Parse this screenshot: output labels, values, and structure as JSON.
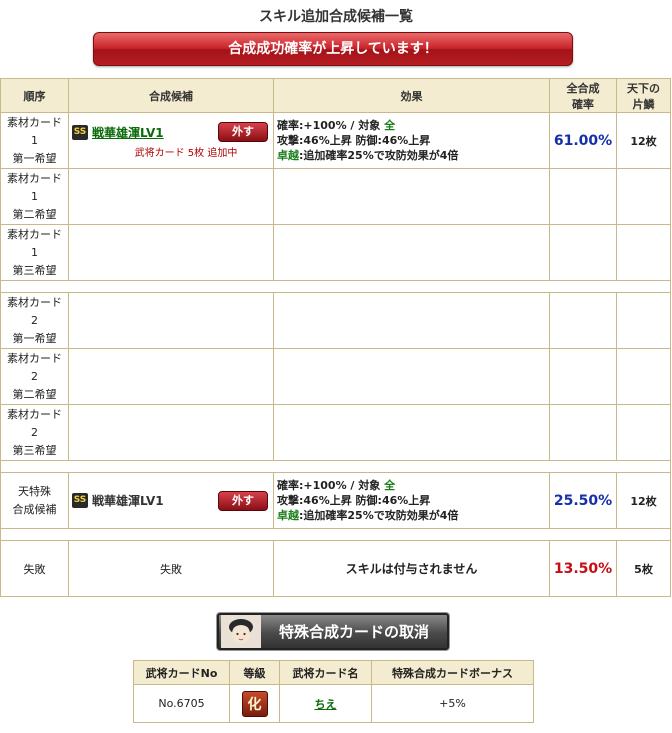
{
  "page_title": "スキル追加合成候補一覧",
  "banner_text": "合成成功確率が上昇しています！",
  "headers": {
    "order": "順序",
    "candidate": "合成候補",
    "effect": "効果",
    "rate_line1": "全合成",
    "rate_line2": "確率",
    "count_line1": "天下の",
    "count_line2": "片鱗"
  },
  "rows": {
    "r1": {
      "order1": "素材カード1",
      "order2": "第一希望",
      "badge": "SS",
      "card": "戦華雄渾LV1",
      "remove": "外す",
      "note": "武将カード 5枚 追加中",
      "eff1a": "確率:+100% / 対象 ",
      "eff1b": "全",
      "eff2": "攻撃:46%上昇 防御:46%上昇",
      "eff3a": "卓越",
      "eff3b": ":追加確率25%で攻防効果が4倍",
      "rate": "61.00%",
      "count": "12枚"
    },
    "r2": {
      "order1": "素材カード1",
      "order2": "第二希望"
    },
    "r3": {
      "order1": "素材カード1",
      "order2": "第三希望"
    },
    "r4": {
      "order1": "素材カード2",
      "order2": "第一希望"
    },
    "r5": {
      "order1": "素材カード2",
      "order2": "第二希望"
    },
    "r6": {
      "order1": "素材カード2",
      "order2": "第三希望"
    },
    "special": {
      "order1": "天特殊",
      "order2": "合成候補",
      "badge": "SS",
      "card": "戦華雄渾LV1",
      "remove": "外す",
      "eff1a": "確率:+100% / 対象 ",
      "eff1b": "全",
      "eff2": "攻撃:46%上昇 防御:46%上昇",
      "eff3a": "卓越",
      "eff3b": ":追加確率25%で攻防効果が4倍",
      "rate": "25.50%",
      "count": "12枚"
    },
    "fail": {
      "order": "失敗",
      "candidate": "失敗",
      "effect": "スキルは付与されません",
      "rate": "13.50%",
      "count": "5枚"
    }
  },
  "cancel_button": "特殊合成カードの取消",
  "sub_table": {
    "headers": [
      "武将カードNo",
      "等級",
      "武将カード名",
      "特殊合成カードボーナス"
    ],
    "row": {
      "no": "No.6705",
      "grade": "化",
      "name": "ちえ",
      "bonus": "+5%"
    }
  },
  "colors": {
    "banner": "#c9242b",
    "rate_blue": "#1530a8",
    "rate_red": "#c50e16",
    "border": "#c9b98a",
    "header_bg": "#f4ecd0"
  }
}
